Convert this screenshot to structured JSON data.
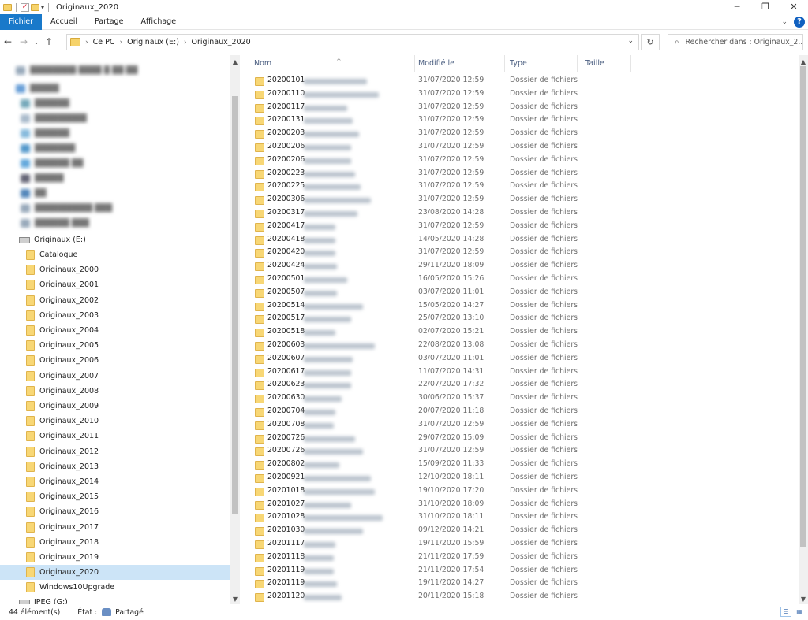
{
  "window": {
    "title": "Originaux_2020"
  },
  "ribbon": {
    "tabs": [
      "Fichier",
      "Accueil",
      "Partage",
      "Affichage"
    ]
  },
  "nav": {
    "breadcrumb": [
      "Ce PC",
      "Originaux (E:)",
      "Originaux_2020"
    ],
    "search_placeholder": "Rechercher dans : Originaux_2..."
  },
  "sidebar": {
    "drive_label": "Originaux (E:)",
    "folders": [
      "Catalogue",
      "Originaux_2000",
      "Originaux_2001",
      "Originaux_2002",
      "Originaux_2003",
      "Originaux_2004",
      "Originaux_2005",
      "Originaux_2006",
      "Originaux_2007",
      "Originaux_2008",
      "Originaux_2009",
      "Originaux_2010",
      "Originaux_2011",
      "Originaux_2012",
      "Originaux_2013",
      "Originaux_2014",
      "Originaux_2015",
      "Originaux_2016",
      "Originaux_2017",
      "Originaux_2018",
      "Originaux_2019",
      "Originaux_2020",
      "Windows10Upgrade"
    ],
    "selected": "Originaux_2020",
    "next_drive_label": "JPEG (G:)"
  },
  "columns": {
    "name": "Nom",
    "modified": "Modifié le",
    "type": "Type",
    "size": "Taille"
  },
  "files": [
    {
      "name": "20200101",
      "date": "31/07/2020 12:59",
      "type": "Dossier de fichiers"
    },
    {
      "name": "20200110",
      "date": "31/07/2020 12:59",
      "type": "Dossier de fichiers"
    },
    {
      "name": "20200117",
      "date": "31/07/2020 12:59",
      "type": "Dossier de fichiers"
    },
    {
      "name": "20200131",
      "date": "31/07/2020 12:59",
      "type": "Dossier de fichiers"
    },
    {
      "name": "20200203",
      "date": "31/07/2020 12:59",
      "type": "Dossier de fichiers"
    },
    {
      "name": "20200206",
      "date": "31/07/2020 12:59",
      "type": "Dossier de fichiers"
    },
    {
      "name": "20200206",
      "date": "31/07/2020 12:59",
      "type": "Dossier de fichiers"
    },
    {
      "name": "20200223",
      "date": "31/07/2020 12:59",
      "type": "Dossier de fichiers"
    },
    {
      "name": "20200225",
      "date": "31/07/2020 12:59",
      "type": "Dossier de fichiers"
    },
    {
      "name": "20200306",
      "date": "31/07/2020 12:59",
      "type": "Dossier de fichiers"
    },
    {
      "name": "20200317",
      "date": "23/08/2020 14:28",
      "type": "Dossier de fichiers"
    },
    {
      "name": "20200417",
      "date": "31/07/2020 12:59",
      "type": "Dossier de fichiers"
    },
    {
      "name": "20200418",
      "date": "14/05/2020 14:28",
      "type": "Dossier de fichiers"
    },
    {
      "name": "20200420",
      "date": "31/07/2020 12:59",
      "type": "Dossier de fichiers"
    },
    {
      "name": "20200424",
      "date": "29/11/2020 18:09",
      "type": "Dossier de fichiers"
    },
    {
      "name": "20200501",
      "date": "16/05/2020 15:26",
      "type": "Dossier de fichiers"
    },
    {
      "name": "20200507",
      "date": "03/07/2020 11:01",
      "type": "Dossier de fichiers"
    },
    {
      "name": "20200514",
      "date": "15/05/2020 14:27",
      "type": "Dossier de fichiers"
    },
    {
      "name": "20200517",
      "date": "25/07/2020 13:10",
      "type": "Dossier de fichiers"
    },
    {
      "name": "20200518",
      "date": "02/07/2020 15:21",
      "type": "Dossier de fichiers"
    },
    {
      "name": "20200603",
      "date": "22/08/2020 13:08",
      "type": "Dossier de fichiers"
    },
    {
      "name": "20200607",
      "date": "03/07/2020 11:01",
      "type": "Dossier de fichiers"
    },
    {
      "name": "20200617",
      "date": "11/07/2020 14:31",
      "type": "Dossier de fichiers"
    },
    {
      "name": "20200623",
      "date": "22/07/2020 17:32",
      "type": "Dossier de fichiers"
    },
    {
      "name": "20200630",
      "date": "30/06/2020 15:37",
      "type": "Dossier de fichiers"
    },
    {
      "name": "20200704",
      "date": "20/07/2020 11:18",
      "type": "Dossier de fichiers"
    },
    {
      "name": "20200708",
      "date": "31/07/2020 12:59",
      "type": "Dossier de fichiers"
    },
    {
      "name": "20200726",
      "date": "29/07/2020 15:09",
      "type": "Dossier de fichiers"
    },
    {
      "name": "20200726",
      "date": "31/07/2020 12:59",
      "type": "Dossier de fichiers"
    },
    {
      "name": "20200802",
      "date": "15/09/2020 11:33",
      "type": "Dossier de fichiers"
    },
    {
      "name": "20200921",
      "date": "12/10/2020 18:11",
      "type": "Dossier de fichiers"
    },
    {
      "name": "20201018",
      "date": "19/10/2020 17:20",
      "type": "Dossier de fichiers"
    },
    {
      "name": "20201027",
      "date": "31/10/2020 18:09",
      "type": "Dossier de fichiers"
    },
    {
      "name": "20201028",
      "date": "31/10/2020 18:11",
      "type": "Dossier de fichiers"
    },
    {
      "name": "20201030",
      "date": "09/12/2020 14:21",
      "type": "Dossier de fichiers"
    },
    {
      "name": "20201117",
      "date": "19/11/2020 15:59",
      "type": "Dossier de fichiers"
    },
    {
      "name": "20201118",
      "date": "21/11/2020 17:59",
      "type": "Dossier de fichiers"
    },
    {
      "name": "20201119",
      "date": "21/11/2020 17:54",
      "type": "Dossier de fichiers"
    },
    {
      "name": "20201119",
      "date": "19/11/2020 14:27",
      "type": "Dossier de fichiers"
    },
    {
      "name": "20201120",
      "date": "20/11/2020 15:18",
      "type": "Dossier de fichiers"
    }
  ],
  "status": {
    "count": "44 élément(s)",
    "state_label": "État :",
    "state_value": "Partagé"
  }
}
